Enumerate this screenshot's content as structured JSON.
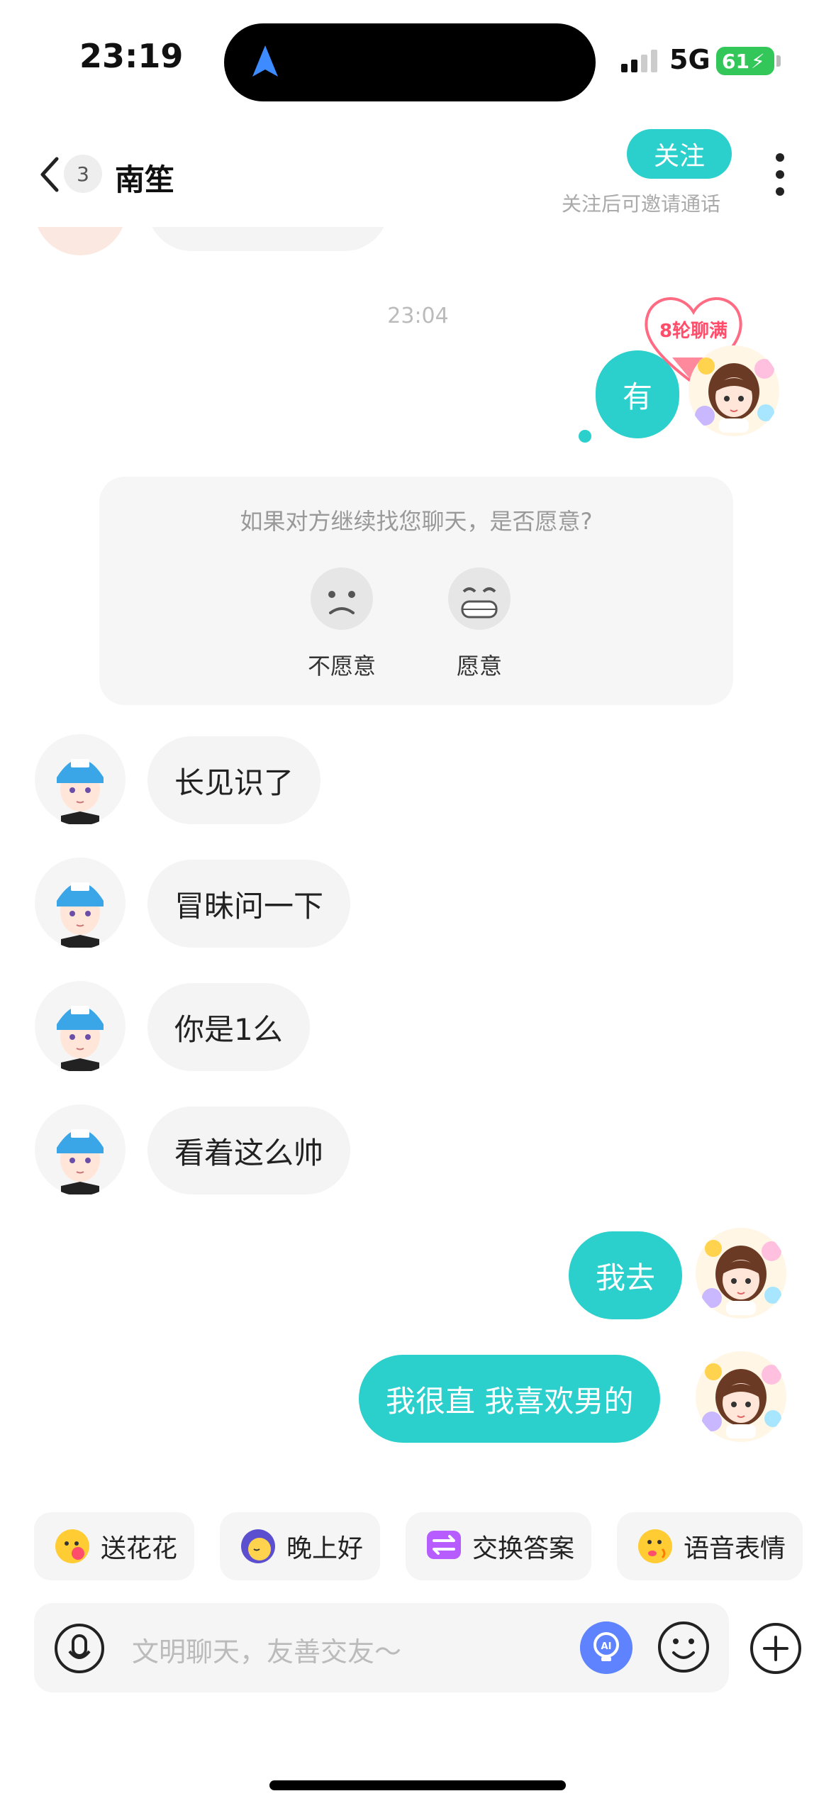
{
  "status_bar": {
    "time": "23:19",
    "network": "5G",
    "battery": "61"
  },
  "header": {
    "unread_count": "3",
    "contact_name": "南笙",
    "follow_label": "关注",
    "follow_hint": "关注后可邀请通话"
  },
  "chat": {
    "timestamp": "23:04",
    "heart_badge": "8轮聊满",
    "messages": [
      {
        "side": "right",
        "text": "有"
      },
      {
        "side": "left",
        "text": "长见识了"
      },
      {
        "side": "left",
        "text": "冒昧问一下"
      },
      {
        "side": "left",
        "text": "你是1么"
      },
      {
        "side": "left",
        "text": "看着这么帅"
      },
      {
        "side": "right",
        "text": "我去"
      },
      {
        "side": "right",
        "text": "我很直 我喜欢男的"
      }
    ]
  },
  "survey": {
    "question": "如果对方继续找您聊天，是否愿意?",
    "options": [
      {
        "label": "不愿意",
        "icon": "sad-face-icon"
      },
      {
        "label": "愿意",
        "icon": "grin-face-icon"
      }
    ]
  },
  "quick_replies": [
    {
      "label": "送花花",
      "icon": "flower-kiss-icon"
    },
    {
      "label": "晚上好",
      "icon": "moon-sleep-icon"
    },
    {
      "label": "交换答案",
      "icon": "exchange-icon"
    },
    {
      "label": "语音表情",
      "icon": "voice-emoji-icon"
    }
  ],
  "input": {
    "placeholder": "文明聊天，友善交友～"
  },
  "colors": {
    "accent": "#2bd0cd",
    "bubble_left": "#f4f4f4",
    "heart": "#ff4d6b"
  }
}
